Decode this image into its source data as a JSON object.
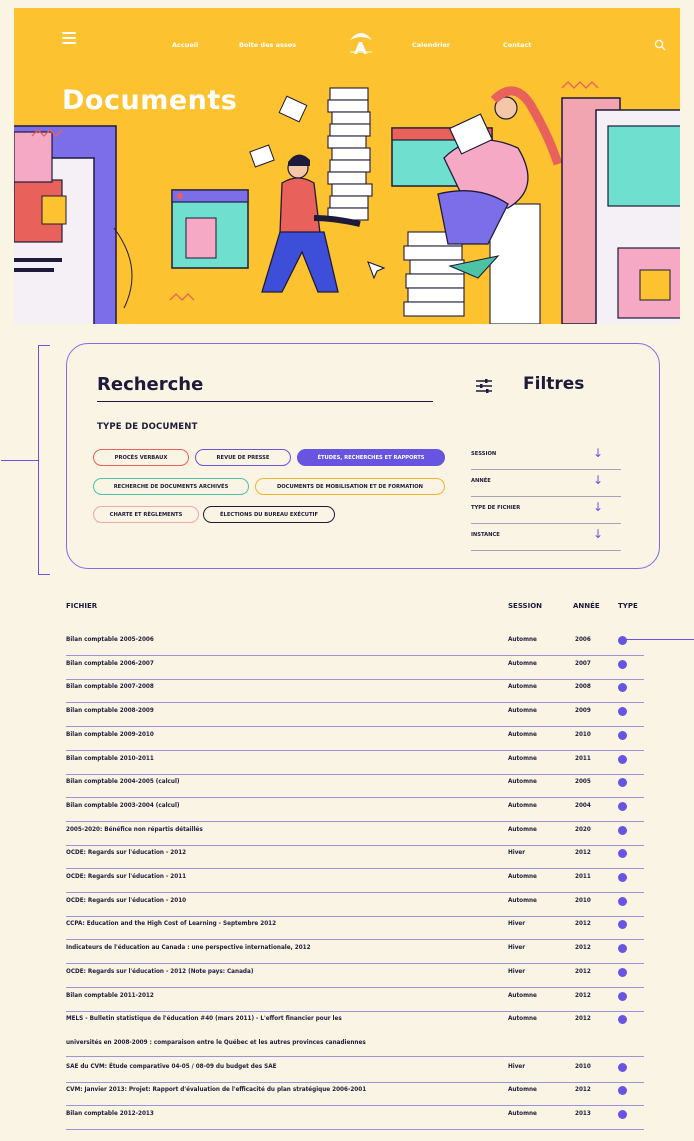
{
  "nav": {
    "links": [
      "Accueil",
      "Boîte des assos",
      "Calendrier",
      "Contact"
    ]
  },
  "hero": {
    "title": "Documents"
  },
  "search": {
    "title": "Recherche",
    "type_label": "TYPE DE DOCUMENT",
    "chips": [
      {
        "label": "PROCÈS VERBAUX",
        "color": "#e8615a",
        "active": false
      },
      {
        "label": "REVUE DE PRESSE",
        "color": "#6754e0",
        "active": false
      },
      {
        "label": "ÉTUDES, RECHERCHES ET RAPPORTS",
        "color": "#6754e0",
        "active": true
      },
      {
        "label": "RECHERCHE DE DOCUMENTS ARCHIVÉS",
        "color": "#4cc3a5",
        "active": false
      },
      {
        "label": "DOCUMENTS DE MOBILISATION ET DE FORMATION",
        "color": "#f2b42f",
        "active": false
      },
      {
        "label": "CHARTE ET RÈGLEMENTS",
        "color": "#f0a5b0",
        "active": false
      },
      {
        "label": "ÉLECTIONS DU BUREAU EXÉCUTIF",
        "color": "#1e1b3a",
        "active": false
      }
    ]
  },
  "filters": {
    "title": "Filtres",
    "items": [
      "SESSION",
      "ANNÉE",
      "TYPE DE FICHIER",
      "INSTANCE"
    ]
  },
  "table": {
    "headers": {
      "fichier": "FICHIER",
      "session": "SESSION",
      "annee": "ANNÉE",
      "type": "TYPE"
    },
    "rows": [
      {
        "name": "Bilan comptable 2005-2006",
        "session": "Automne",
        "annee": "2006"
      },
      {
        "name": "Bilan comptable 2006-2007",
        "session": "Automne",
        "annee": "2007"
      },
      {
        "name": "Bilan comptable 2007-2008",
        "session": "Automne",
        "annee": "2008"
      },
      {
        "name": "Bilan comptable 2008-2009",
        "session": "Automne",
        "annee": "2009"
      },
      {
        "name": "Bilan comptable 2009-2010",
        "session": "Automne",
        "annee": "2010"
      },
      {
        "name": "Bilan comptable 2010-2011",
        "session": "Automne",
        "annee": "2011"
      },
      {
        "name": "Bilan comptable 2004-2005 (calcul)",
        "session": "Automne",
        "annee": "2005"
      },
      {
        "name": "Bilan comptable 2003-2004 (calcul)",
        "session": "Automne",
        "annee": "2004"
      },
      {
        "name": "2005-2020: Bénéfice non répartis détaillés",
        "session": "Automne",
        "annee": "2020"
      },
      {
        "name": "OCDE: Regards sur l'éducation - 2012",
        "session": "Hiver",
        "annee": "2012"
      },
      {
        "name": "OCDE: Regards sur l'éducation - 2011",
        "session": "Automne",
        "annee": "2011"
      },
      {
        "name": "OCDE: Regards sur l'éducation - 2010",
        "session": "Automne",
        "annee": "2010"
      },
      {
        "name": "CCPA: Education and the High Cost of Learning - Septembre 2012",
        "session": "Hiver",
        "annee": "2012"
      },
      {
        "name": "Indicateurs de l'éducation au Canada : une perspective internationale, 2012",
        "session": "Hiver",
        "annee": "2012"
      },
      {
        "name": "OCDE: Regards sur l'éducation - 2012 (Note pays: Canada)",
        "session": "Hiver",
        "annee": "2012"
      },
      {
        "name": "Bilan comptable 2011-2012",
        "session": "Automne",
        "annee": "2012"
      },
      {
        "name": "MELS - Bulletin statistique de l'éducation #40 (mars 2011) - L'effort financier pour les",
        "name2": "universités en 2008-2009 : comparaison entre le Québec et les autres provinces canadiennes",
        "session": "Automne",
        "annee": "2012"
      },
      {
        "name": "SAE du CVM: Étude comparative 04-05 / 08-09 du budget des SAE",
        "session": "Hiver",
        "annee": "2010"
      },
      {
        "name": "CVM: Janvier 2013: Projet: Rapport d'évaluation de l'efficacité du plan stratégique 2006-2001",
        "session": "Automne",
        "annee": "2012"
      },
      {
        "name": "Bilan comptable 2012-2013",
        "session": "Automne",
        "annee": "2013"
      }
    ]
  }
}
